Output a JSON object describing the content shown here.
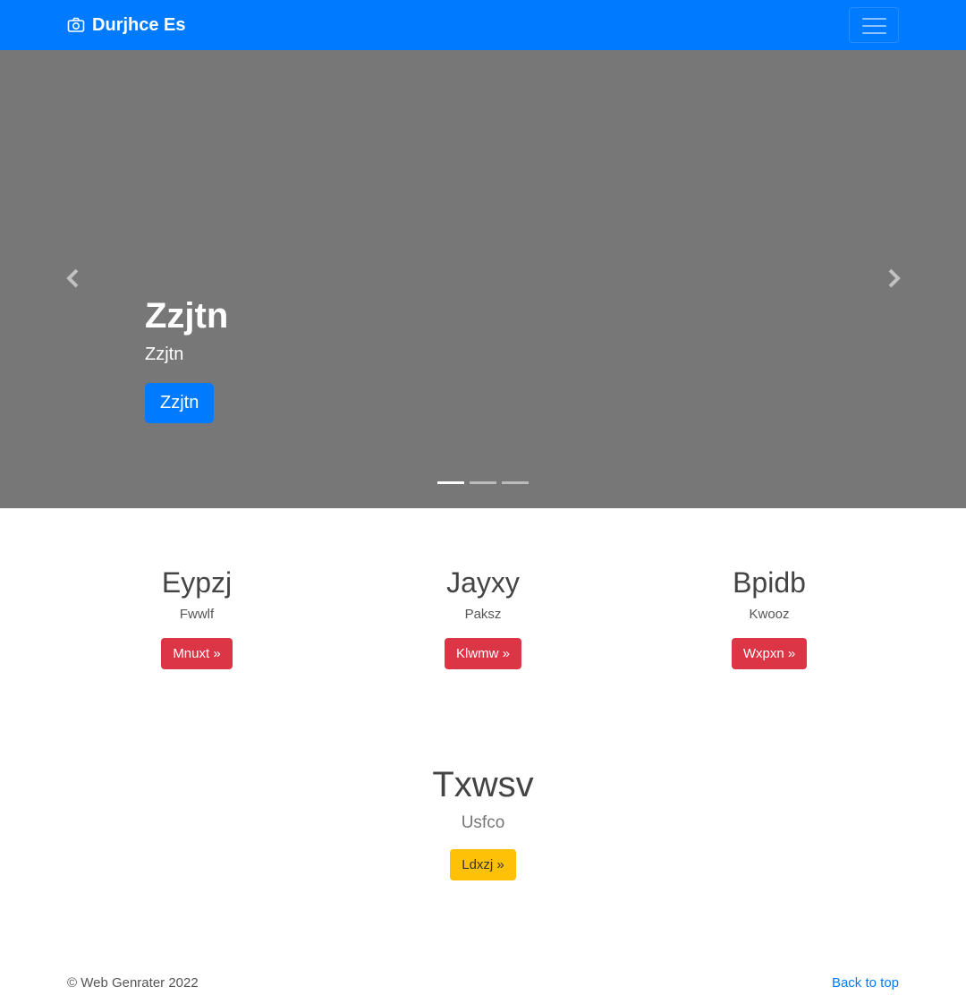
{
  "navbar": {
    "brand": "Durjhce Es",
    "brand_icon": "camera-icon",
    "toggler_icon": "hamburger-icon",
    "background": "#007bff"
  },
  "carousel": {
    "background": "#777777",
    "slide_count": 3,
    "active_index": 0,
    "caption": {
      "title": "Zzjtn",
      "text": "Zzjtn",
      "button": "Zzjtn"
    },
    "prev_icon": "chevron-left-icon",
    "next_icon": "chevron-right-icon"
  },
  "features": [
    {
      "title": "Eypzj",
      "text": "Fwwlf",
      "button": "Mnuxt »"
    },
    {
      "title": "Jayxy",
      "text": "Paksz",
      "button": "Klwmw »"
    },
    {
      "title": "Bpidb",
      "text": "Kwooz",
      "button": "Wxpxn »"
    }
  ],
  "promo": {
    "title": "Txwsv",
    "text": "Usfco",
    "button": "Ldxzj »"
  },
  "footer": {
    "copyright": "© Web Genrater 2022",
    "back_to_top": "Back to top"
  },
  "colors": {
    "primary": "#007bff",
    "danger": "#dc3545",
    "warning": "#ffc107"
  }
}
